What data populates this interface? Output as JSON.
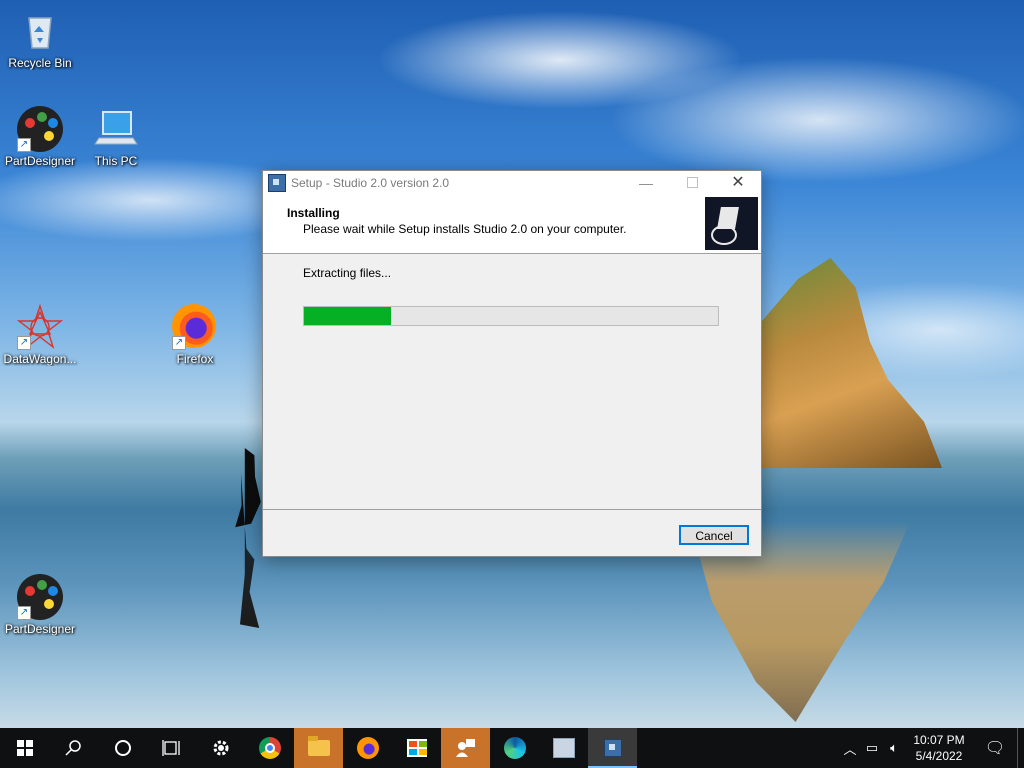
{
  "desktop": {
    "icons": [
      {
        "label": "Recycle Bin",
        "icon": "recycle-bin-icon"
      },
      {
        "label": "PartDesigner",
        "icon": "palette-icon"
      },
      {
        "label": "This PC",
        "icon": "computer-icon"
      },
      {
        "label": "DataWagon...",
        "icon": "datawagon-icon"
      },
      {
        "label": "Firefox",
        "icon": "firefox-icon"
      },
      {
        "label": "PartDesigner",
        "icon": "palette-icon"
      }
    ]
  },
  "window": {
    "title": "Setup - Studio 2.0 version 2.0",
    "minimize_symbol": "—",
    "close_symbol": "✕",
    "header_title": "Installing",
    "header_subtitle": "Please wait while Setup installs Studio 2.0 on your computer.",
    "status": "Extracting files...",
    "progress_fraction": 0.21,
    "cancel_label": "Cancel",
    "accent": "#0078d7",
    "progress_color": "#06b025"
  },
  "taskbar": {
    "items": [
      "start-icon",
      "search-icon",
      "cortana-icon",
      "task-view-icon",
      "settings-icon",
      "chrome-icon",
      "file-explorer-icon",
      "firefox-icon",
      "store-icon",
      "people-icon",
      "edge-icon",
      "app-icon",
      "setup-icon"
    ],
    "tray": {
      "time": "10:07 PM",
      "date": "5/4/2022"
    }
  }
}
